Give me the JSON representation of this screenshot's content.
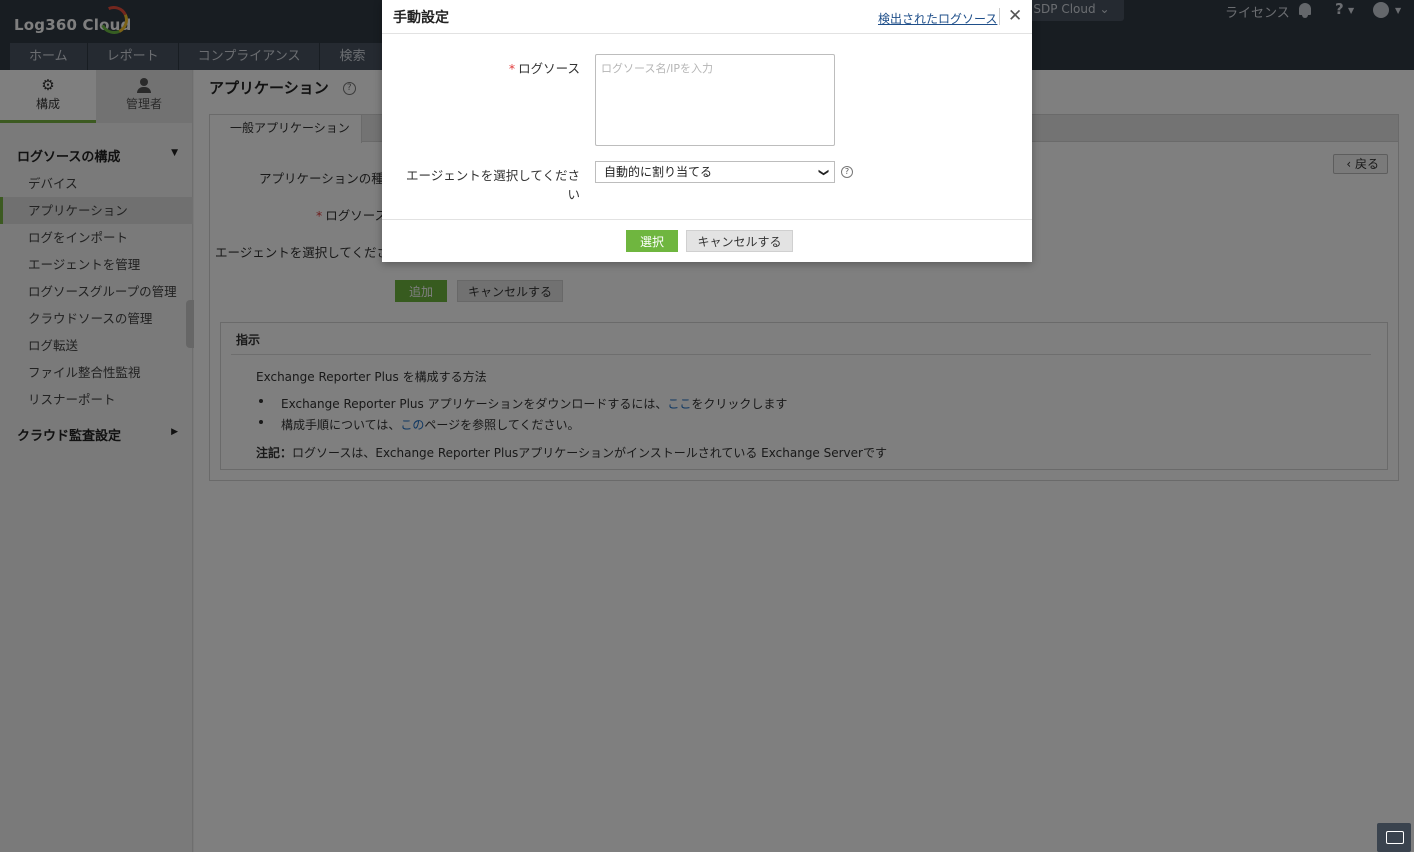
{
  "app": {
    "logo": "Log360 Cloud"
  },
  "nav": {
    "tabs": [
      "ホーム",
      "レポート",
      "コンプライアンス",
      "検索"
    ],
    "sdp_label": "n SDP Cloud",
    "license": "ライセンス",
    "help": "?"
  },
  "sidebar": {
    "tab_config": "構成",
    "tab_admin": "管理者",
    "section1": "ログソースの構成",
    "items": [
      "デバイス",
      "アプリケーション",
      "ログをインポート",
      "エージェントを管理",
      "ログソースグループの管理",
      "クラウドソースの管理",
      "ログ転送",
      "ファイル整合性監視",
      "リスナーポート"
    ],
    "section2": "クラウド監査設定"
  },
  "main": {
    "title": "アプリケーション",
    "tab_general": "一般アプリケーション",
    "back": "戻る",
    "app_type_label": "アプリケーションの種類",
    "log_source_label": "ログソース",
    "agent_label": "エージェントを選択してください",
    "add_btn": "追加",
    "cancel_btn": "キャンセルする",
    "instructions": {
      "title": "指示",
      "heading": "Exchange Reporter Plus を構成する方法",
      "bullet1_a": "Exchange Reporter Plus アプリケーションをダウンロードするには、",
      "bullet1_link": "ここ",
      "bullet1_b": "をクリックします",
      "bullet2_a": "構成手順については、",
      "bullet2_link": "この",
      "bullet2_b": "ページを参照してください。",
      "note_label": "注記：",
      "note": "ログソースは、Exchange Reporter Plusアプリケーションがインストールされている Exchange Serverです"
    }
  },
  "dialog": {
    "title": "手動設定",
    "detected_link": "検出されたログソース",
    "log_source_label": "ログソース",
    "log_source_placeholder": "ログソース名/IPを入力",
    "agent_label": "エージェントを選択してください",
    "agent_value": "自動的に割り当てる",
    "select_btn": "選択",
    "cancel_btn": "キャンセルする"
  }
}
